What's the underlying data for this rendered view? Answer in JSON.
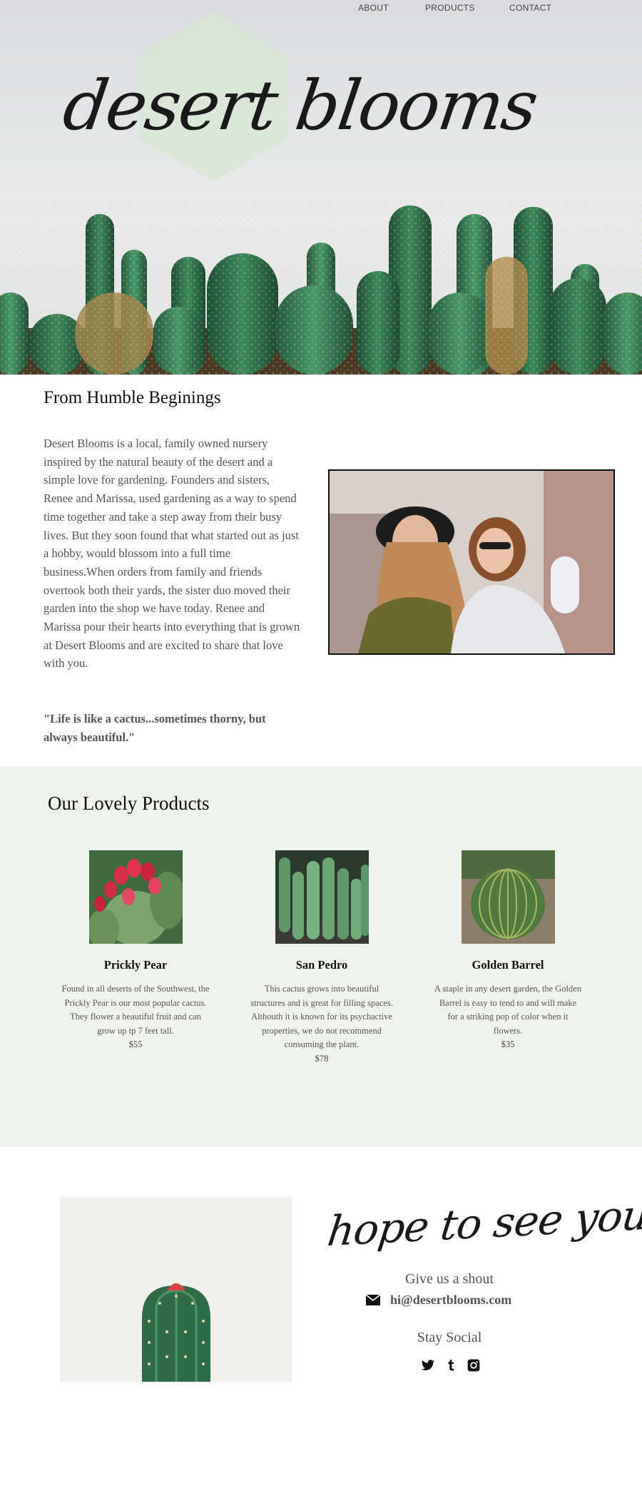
{
  "nav": {
    "about": "ABOUT",
    "products": "PRODUCTS",
    "contact": "CONTACT"
  },
  "hero": {
    "logo": "desert blooms"
  },
  "about": {
    "title": "From Humble Beginings",
    "body": "Desert Blooms is a local, family owned nursery inspired by the natural beauty of the desert and a simple love for gardening. Founders and sisters, Renee and Marissa, used gardening as a way to spend time together and take a step away from their busy lives. But they soon found that what started out as just a hobby, would blossom into a full time business.When orders from family and friends overtook both their yards, the sister duo moved their garden into the shop we have today. Renee and Marissa pour their hearts into everything that is grown at Desert Blooms and are excited to share that love with you.",
    "quote": "\"Life is like a cactus...sometimes thorny, but always beautiful.\""
  },
  "products": {
    "title": "Our Lovely Products",
    "items": [
      {
        "name": "Prickly Pear",
        "description": "Found in all deserts of the Southwest, the Prickly Pear is our most popular cactus. They flower a beautiful fruit and can grow up tp 7 feet tall.",
        "price": "$55"
      },
      {
        "name": "San Pedro",
        "description": "This cactus grows into beautiful structures and is great for filling spaces. Althouth it is known for its psychactive properties, we do not recommend consuming the plant.",
        "price": "$78"
      },
      {
        "name": "Golden Barrel",
        "description": "A staple in any desert garden, the Golden Barrel is easy to tend to and will make for a striking pop of color when it flowers.",
        "price": "$35"
      }
    ]
  },
  "contact": {
    "script": "hope to see you soon!",
    "shout": "Give us a shout",
    "email": "hi@desertblooms.com",
    "social_title": "Stay Social",
    "icons": [
      "envelope-icon",
      "twitter-icon",
      "tumblr-icon",
      "instagram-icon"
    ]
  },
  "colors": {
    "products_bg": "#eef4ec",
    "hex_mint": "#d7e8d2",
    "cactus_green": "#2f6b46"
  }
}
